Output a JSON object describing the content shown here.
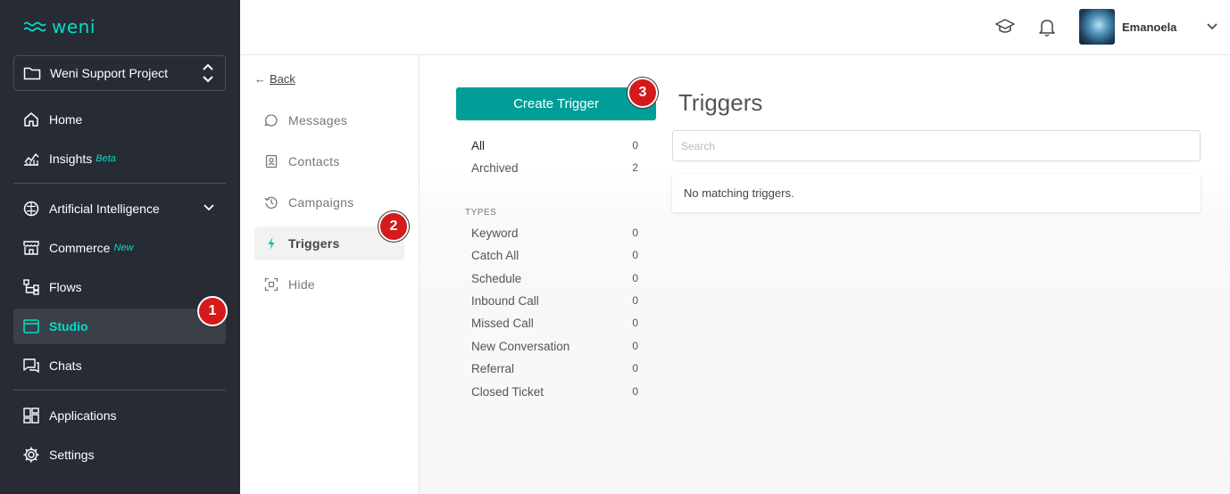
{
  "brand": {
    "logo_text": "weni",
    "accent": "#00dec9",
    "teal_button": "#009e96"
  },
  "sidebar": {
    "project_name": "Weni Support Project",
    "items": [
      {
        "label": "Home",
        "icon": "home-icon"
      },
      {
        "label": "Insights",
        "badge": "Beta",
        "icon": "chart-icon"
      },
      {
        "label": "Artificial Intelligence",
        "icon": "brain-icon"
      },
      {
        "label": "Commerce",
        "badge": "New",
        "icon": "store-icon"
      },
      {
        "label": "Flows",
        "icon": "flow-icon"
      },
      {
        "label": "Studio",
        "icon": "window-icon",
        "active": true
      },
      {
        "label": "Chats",
        "icon": "chat-icon"
      },
      {
        "label": "Applications",
        "icon": "grid-icon"
      },
      {
        "label": "Settings",
        "icon": "gear-icon"
      }
    ]
  },
  "header": {
    "username": "Emanoela"
  },
  "subnav": {
    "back_arrow": "←",
    "back_label": "Back",
    "items": [
      {
        "label": "Messages",
        "icon": "message-icon"
      },
      {
        "label": "Contacts",
        "icon": "contact-icon"
      },
      {
        "label": "Campaigns",
        "icon": "history-icon"
      },
      {
        "label": "Triggers",
        "icon": "bolt-icon",
        "active": true
      },
      {
        "label": "Hide",
        "icon": "hide-icon"
      }
    ]
  },
  "main": {
    "create_button": "Create Trigger",
    "title": "Triggers",
    "search_placeholder": "Search",
    "empty_message": "No matching triggers.",
    "filters": [
      {
        "label": "All",
        "count": "0"
      },
      {
        "label": "Archived",
        "count": "2"
      }
    ],
    "types_header": "TYPES",
    "types": [
      {
        "label": "Keyword",
        "count": "0"
      },
      {
        "label": "Catch All",
        "count": "0"
      },
      {
        "label": "Schedule",
        "count": "0"
      },
      {
        "label": "Inbound Call",
        "count": "0"
      },
      {
        "label": "Missed Call",
        "count": "0"
      },
      {
        "label": "New Conversation",
        "count": "0"
      },
      {
        "label": "Referral",
        "count": "0"
      },
      {
        "label": "Closed Ticket",
        "count": "0"
      }
    ]
  },
  "markers": [
    "1",
    "2",
    "3"
  ]
}
